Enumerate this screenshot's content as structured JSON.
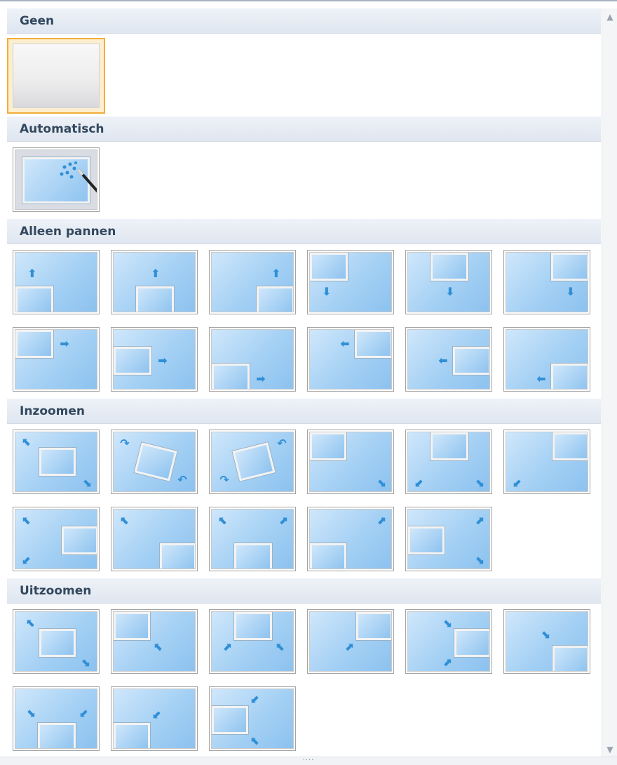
{
  "sections": {
    "none": {
      "label": "Geen"
    },
    "auto": {
      "label": "Automatisch"
    },
    "pan": {
      "label": "Alleen pannen"
    },
    "zoom_in": {
      "label": "Inzoomen"
    },
    "zoom_out": {
      "label": "Uitzoomen"
    }
  },
  "grip": {
    "label": "····"
  },
  "icons": {
    "scroll_up": "▲",
    "scroll_down": "▼"
  },
  "colors": {
    "selection_border": "#f2ad3c",
    "arrow": "#2f8fd6",
    "thumb_sky": "#a4d0f4"
  }
}
